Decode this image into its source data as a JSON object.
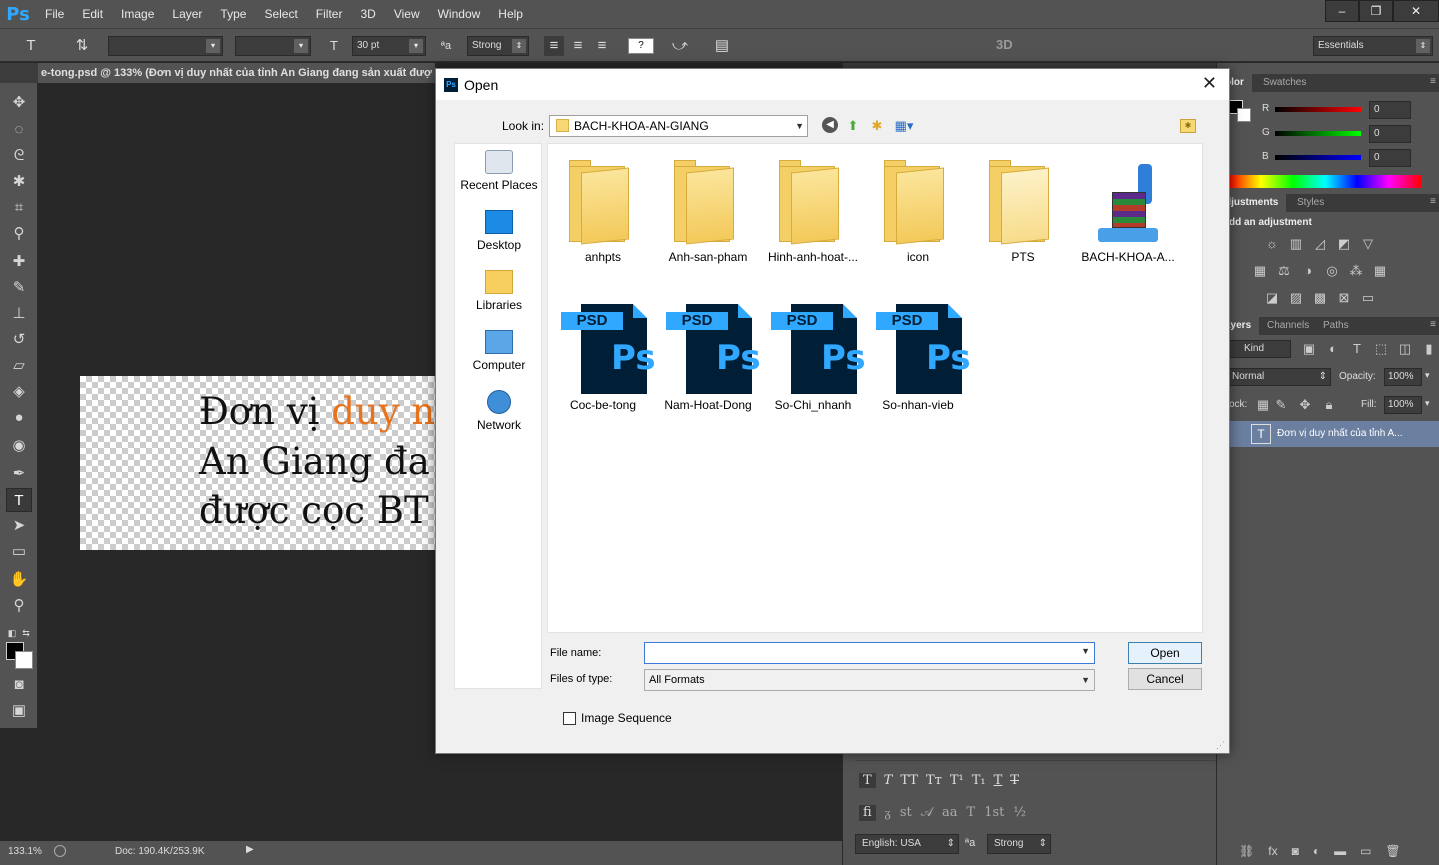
{
  "app": {
    "logo": "Ps"
  },
  "menu": [
    "File",
    "Edit",
    "Image",
    "Layer",
    "Type",
    "Select",
    "Filter",
    "3D",
    "View",
    "Window",
    "Help"
  ],
  "window_controls": {
    "minimize": "–",
    "restore": "❐",
    "close": "✕"
  },
  "options_bar": {
    "font_size": "30 pt",
    "anti_alias": "Strong",
    "workspace_3d": "3D",
    "workspace": "Essentials",
    "warp_label": "?"
  },
  "document": {
    "tab_title": "e-tong.psd @ 133% (Đơn vị duy nhất của tỉnh An Giang đang sản xuất đượ",
    "canvas_line1_black": "Đơn vị ",
    "canvas_line1_orange": "duy n",
    "canvas_line2": "An Giang đa",
    "canvas_line3": "được cọc BT"
  },
  "status_bar": {
    "zoom": "133.1%",
    "doc": "Doc: 190.4K/253.9K"
  },
  "panels": {
    "color_tabs": [
      "olor",
      "Swatches"
    ],
    "rgb": [
      {
        "label": "R",
        "value": "0",
        "color": "#ff0000"
      },
      {
        "label": "G",
        "value": "0",
        "color": "#00ff00"
      },
      {
        "label": "B",
        "value": "0",
        "color": "#0000ff"
      }
    ],
    "adjust_tabs": [
      "djustments",
      "Styles"
    ],
    "adjust_hint": "dd an adjustment",
    "layer_tabs": [
      "ayers",
      "Channels",
      "Paths"
    ],
    "layer_kind": "Kind",
    "blend_mode": "Normal",
    "opacity_label": "Opacity:",
    "opacity": "100%",
    "lock_label": "ock:",
    "fill_label": "Fill:",
    "fill": "100%",
    "layer_name": "Đơn vị duy nhất của tỉnh A..."
  },
  "character_panel": {
    "language": "English: USA",
    "anti_alias": "Strong",
    "aa_label": "ªa"
  },
  "dialog": {
    "title": "Open",
    "close": "✕",
    "look_in_label": "Look in:",
    "look_in_value": "BACH-KHOA-AN-GIANG",
    "places": [
      "Recent Places",
      "Desktop",
      "Libraries",
      "Computer",
      "Network"
    ],
    "folders": [
      "anhpts",
      "Anh-san-pham",
      "Hinh-anh-hoat-...",
      "icon",
      "PTS",
      "BACH-KHOA-A..."
    ],
    "psd_files": [
      "Coc-be-tong",
      "Nam-Hoat-Dong",
      "So-Chi_nhanh",
      "So-nhan-vieb"
    ],
    "psd_badge": "PSD",
    "psd_glyph": "Ps",
    "file_name_label": "File name:",
    "file_name_value": "",
    "files_of_type_label": "Files of type:",
    "files_of_type_value": "All Formats",
    "open_button": "Open",
    "cancel_button": "Cancel",
    "image_sequence_label": "Image Sequence"
  }
}
